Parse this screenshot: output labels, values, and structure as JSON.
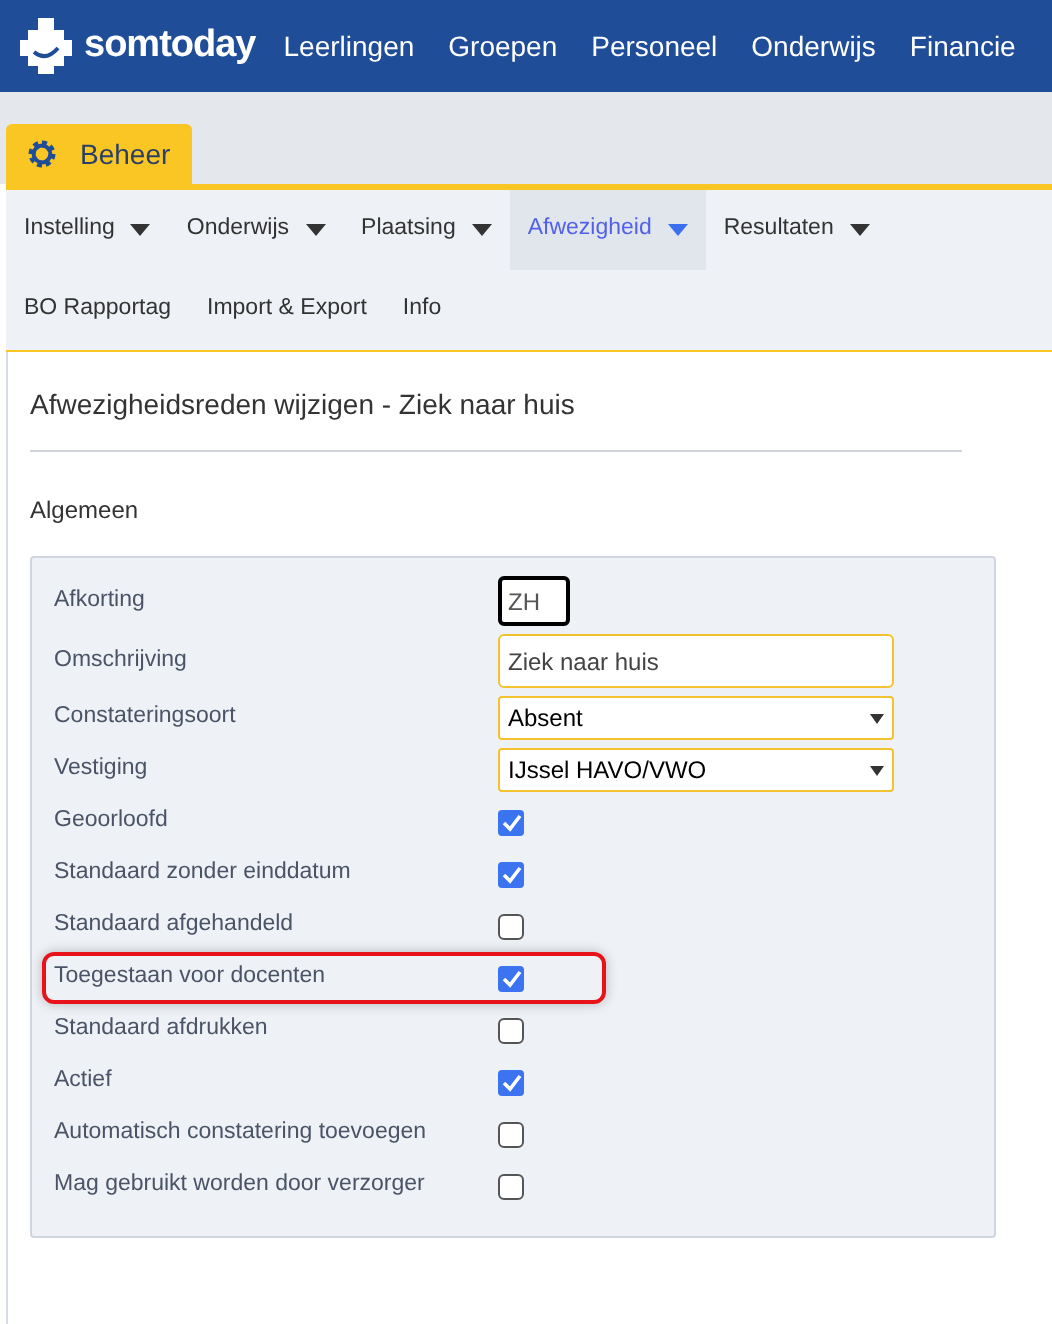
{
  "header": {
    "logo": "somtoday",
    "nav": [
      "Leerlingen",
      "Groepen",
      "Personeel",
      "Onderwijs",
      "Financie"
    ]
  },
  "module_tab": {
    "label": "Beheer",
    "selected": true
  },
  "menu": [
    {
      "label": "Instelling",
      "dropdown": true,
      "selected": false
    },
    {
      "label": "Onderwijs",
      "dropdown": true,
      "selected": false
    },
    {
      "label": "Plaatsing",
      "dropdown": true,
      "selected": false
    },
    {
      "label": "Afwezigheid",
      "dropdown": true,
      "selected": true
    },
    {
      "label": "Resultaten",
      "dropdown": true,
      "selected": false
    },
    {
      "label": "BO Rapportag",
      "dropdown": false,
      "selected": false
    },
    {
      "label": "Import & Export",
      "dropdown": false,
      "selected": false
    },
    {
      "label": "Info",
      "dropdown": false,
      "selected": false
    }
  ],
  "page_title": "Afwezigheidsreden wijzigen - Ziek naar huis",
  "section_title": "Algemeen",
  "fields": [
    {
      "kind": "text",
      "label": "Afkorting",
      "value": "ZH",
      "focused": true,
      "highlighted": false
    },
    {
      "kind": "text",
      "label": "Omschrijving",
      "value": "Ziek naar huis",
      "focused": false,
      "highlighted": false
    },
    {
      "kind": "select",
      "label": "Constateringsoort",
      "value": "Absent",
      "highlighted": false
    },
    {
      "kind": "select",
      "label": "Vestiging",
      "value": "IJssel HAVO/VWO",
      "highlighted": false
    },
    {
      "kind": "checkbox",
      "label": "Geoorloofd",
      "checked": true,
      "highlighted": false
    },
    {
      "kind": "checkbox",
      "label": "Standaard zonder einddatum",
      "checked": true,
      "highlighted": false
    },
    {
      "kind": "checkbox",
      "label": "Standaard afgehandeld",
      "checked": false,
      "highlighted": false
    },
    {
      "kind": "checkbox",
      "label": "Toegestaan voor docenten",
      "checked": true,
      "highlighted": true
    },
    {
      "kind": "checkbox",
      "label": "Standaard afdrukken",
      "checked": false,
      "highlighted": false
    },
    {
      "kind": "checkbox",
      "label": "Actief",
      "checked": true,
      "highlighted": false
    },
    {
      "kind": "checkbox",
      "label": "Automatisch constatering toevoegen",
      "checked": false,
      "highlighted": false
    },
    {
      "kind": "checkbox",
      "label": "Mag gebruikt worden door verzorger",
      "checked": false,
      "highlighted": false
    }
  ]
}
